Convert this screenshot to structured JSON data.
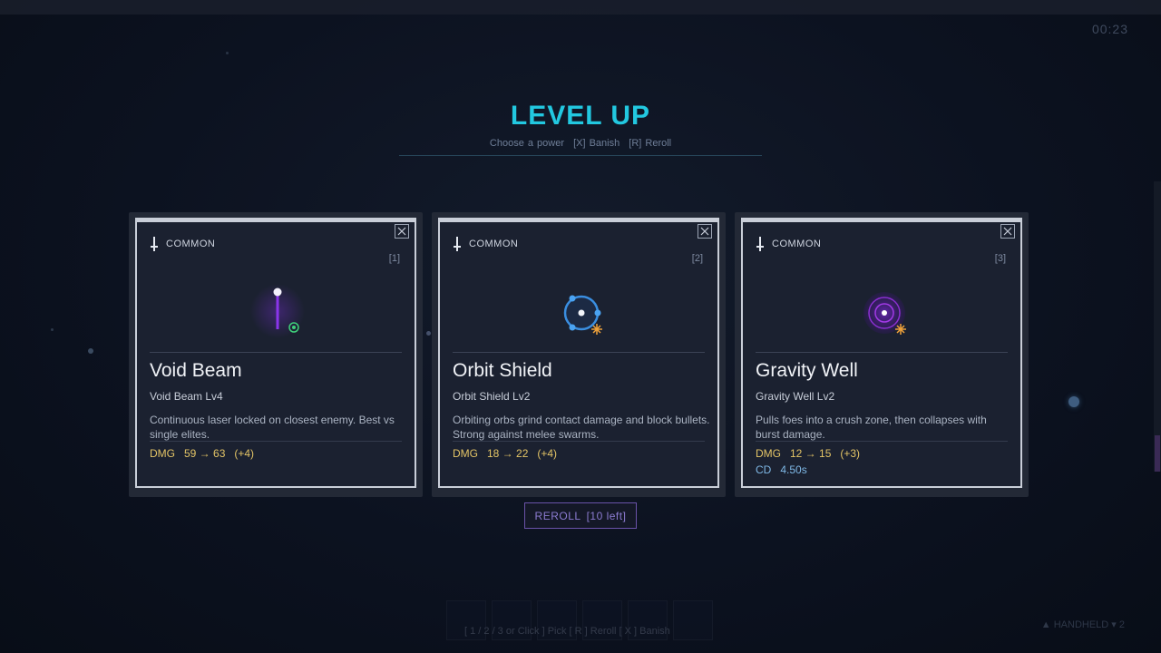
{
  "hud": {
    "timer": "00:23",
    "bottom_hint": "[ 1 / 2 / 3 or Click ] Pick   [ R ] Reroll   [ X ] Banish",
    "corner_hint": "▲ HANDHELD ▾ 2"
  },
  "header": {
    "title": "LEVEL UP",
    "subtitle_choose": "Choose a power",
    "subtitle_banish": "[X] Banish",
    "subtitle_reroll": "[R] Reroll"
  },
  "cards": [
    {
      "rarity": "COMMON",
      "hotkey": "[1]",
      "name": "Void Beam",
      "level": "Void Beam Lv4",
      "description": "Continuous laser locked on closest enemy. Best vs single elites.",
      "dmg_label": "DMG",
      "dmg_change": "59 → 63",
      "dmg_delta": "(+4)",
      "icon": "void-beam-icon",
      "accent": "#7b2fd6"
    },
    {
      "rarity": "COMMON",
      "hotkey": "[2]",
      "name": "Orbit Shield",
      "level": "Orbit Shield Lv2",
      "description": "Orbiting orbs grind contact damage and block bullets. Strong against melee swarms.",
      "dmg_label": "DMG",
      "dmg_change": "18 → 22",
      "dmg_delta": "(+4)",
      "icon": "orbit-shield-icon",
      "accent": "#3a8ee0"
    },
    {
      "rarity": "COMMON",
      "hotkey": "[3]",
      "name": "Gravity Well",
      "level": "Gravity Well Lv2",
      "description": "Pulls foes into a crush zone, then collapses with burst damage.",
      "dmg_label": "DMG",
      "dmg_change": "12 → 15",
      "dmg_delta": "(+3)",
      "cd_label": "CD",
      "cd_value": "4.50s",
      "icon": "gravity-well-icon",
      "accent": "#8a2fd0"
    }
  ],
  "reroll": {
    "label": "REROLL",
    "remaining": "[10 left]"
  },
  "colors": {
    "title": "#22c8e0",
    "dmg": "#e3c466",
    "cd": "#7fb8e6",
    "reroll_border": "#6a52a8",
    "card_border": "#c9ced8"
  }
}
